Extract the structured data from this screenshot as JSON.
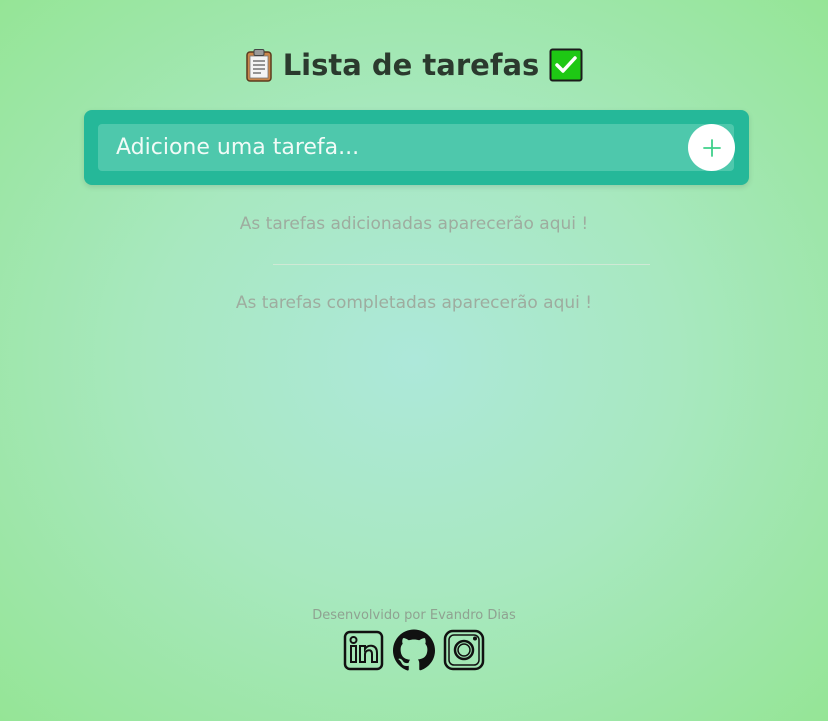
{
  "header": {
    "title": "Lista de tarefas",
    "left_icon": "clipboard-icon",
    "right_icon": "check-mark-button-icon"
  },
  "new_task": {
    "placeholder": "Adicione uma tarefa...",
    "value": "",
    "add_icon": "plus-icon"
  },
  "pending": {
    "empty_message": "As tarefas adicionadas aparecerão aqui !"
  },
  "completed": {
    "empty_message": "As tarefas completadas aparecerão aqui !"
  },
  "footer": {
    "credit": "Desenvolvido por Evandro Dias",
    "links": [
      {
        "icon": "linkedin-icon"
      },
      {
        "icon": "github-icon"
      },
      {
        "icon": "instagram-icon"
      }
    ]
  },
  "colors": {
    "accent": "#25b899",
    "input_bg": "#4ec8ac",
    "add_icon": "#3fd08a",
    "title_text": "#2b3a2e",
    "muted_text": "#9eac9f",
    "check_green": "#1ec814"
  }
}
